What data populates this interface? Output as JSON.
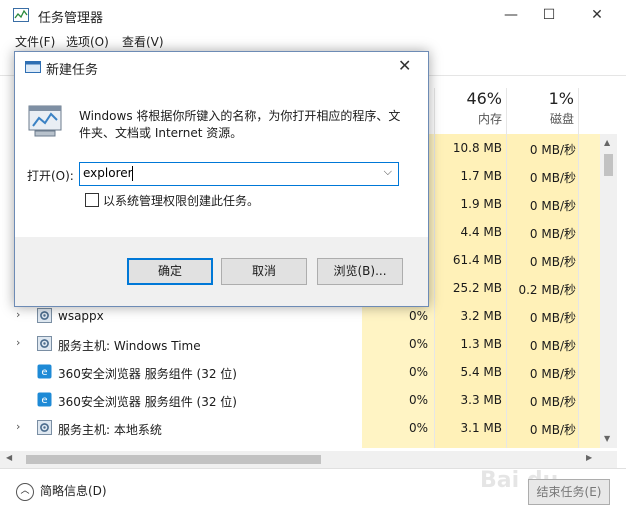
{
  "window": {
    "title": "任务管理器",
    "minimize_glyph": "—",
    "maximize_glyph": "☐",
    "close_glyph": "✕"
  },
  "menu": [
    "文件(F)",
    "选项(O)",
    "查看(V)"
  ],
  "columns": [
    {
      "pct": "46%",
      "label": "内存"
    },
    {
      "pct": "1%",
      "label": "磁盘"
    }
  ],
  "rows": [
    {
      "name": "",
      "cpu": "",
      "mem": "10.8 MB",
      "disk": "0 MB/秒",
      "icon": "",
      "expand": false
    },
    {
      "name": "",
      "cpu": "",
      "mem": "1.7 MB",
      "disk": "0 MB/秒",
      "icon": "",
      "expand": false
    },
    {
      "name": "",
      "cpu": "",
      "mem": "1.9 MB",
      "disk": "0 MB/秒",
      "icon": "",
      "expand": false
    },
    {
      "name": "",
      "cpu": "",
      "mem": "4.4 MB",
      "disk": "0 MB/秒",
      "icon": "",
      "expand": false
    },
    {
      "name": "",
      "cpu": "",
      "mem": "61.4 MB",
      "disk": "0 MB/秒",
      "icon": "",
      "expand": false
    },
    {
      "name": "",
      "cpu": "",
      "mem": "25.2 MB",
      "disk": "0.2 MB/秒",
      "icon": "",
      "expand": false
    },
    {
      "name": "wsappx",
      "cpu": "0%",
      "mem": "3.2 MB",
      "disk": "0 MB/秒",
      "icon": "gear",
      "expand": true
    },
    {
      "name": "服务主机: Windows Time",
      "cpu": "0%",
      "mem": "1.3 MB",
      "disk": "0 MB/秒",
      "icon": "gear",
      "expand": true
    },
    {
      "name": "360安全浏览器 服务组件 (32 位)",
      "cpu": "0%",
      "mem": "5.4 MB",
      "disk": "0 MB/秒",
      "icon": "browser360",
      "expand": false
    },
    {
      "name": "360安全浏览器 服务组件 (32 位)",
      "cpu": "0%",
      "mem": "3.3 MB",
      "disk": "0 MB/秒",
      "icon": "browser360",
      "expand": false
    },
    {
      "name": "服务主机: 本地系统",
      "cpu": "0%",
      "mem": "3.1 MB",
      "disk": "0 MB/秒",
      "icon": "gear",
      "expand": true
    }
  ],
  "footer": {
    "fewer_details": "简略信息(D)",
    "end_task": "结束任务(E)"
  },
  "dialog": {
    "title": "新建任务",
    "description": "Windows 将根据你所键入的名称，为你打开相应的程序、文件夹、文档或 Internet 资源。",
    "open_label": "打开(O):",
    "open_value": "explorer",
    "admin_checkbox_label": "以系统管理权限创建此任务。",
    "admin_checked": false,
    "buttons": {
      "ok": "确定",
      "cancel": "取消",
      "browse": "浏览(B)..."
    }
  },
  "colors": {
    "accent": "#0078d7",
    "highlight_yellow": "#fff1b8"
  }
}
